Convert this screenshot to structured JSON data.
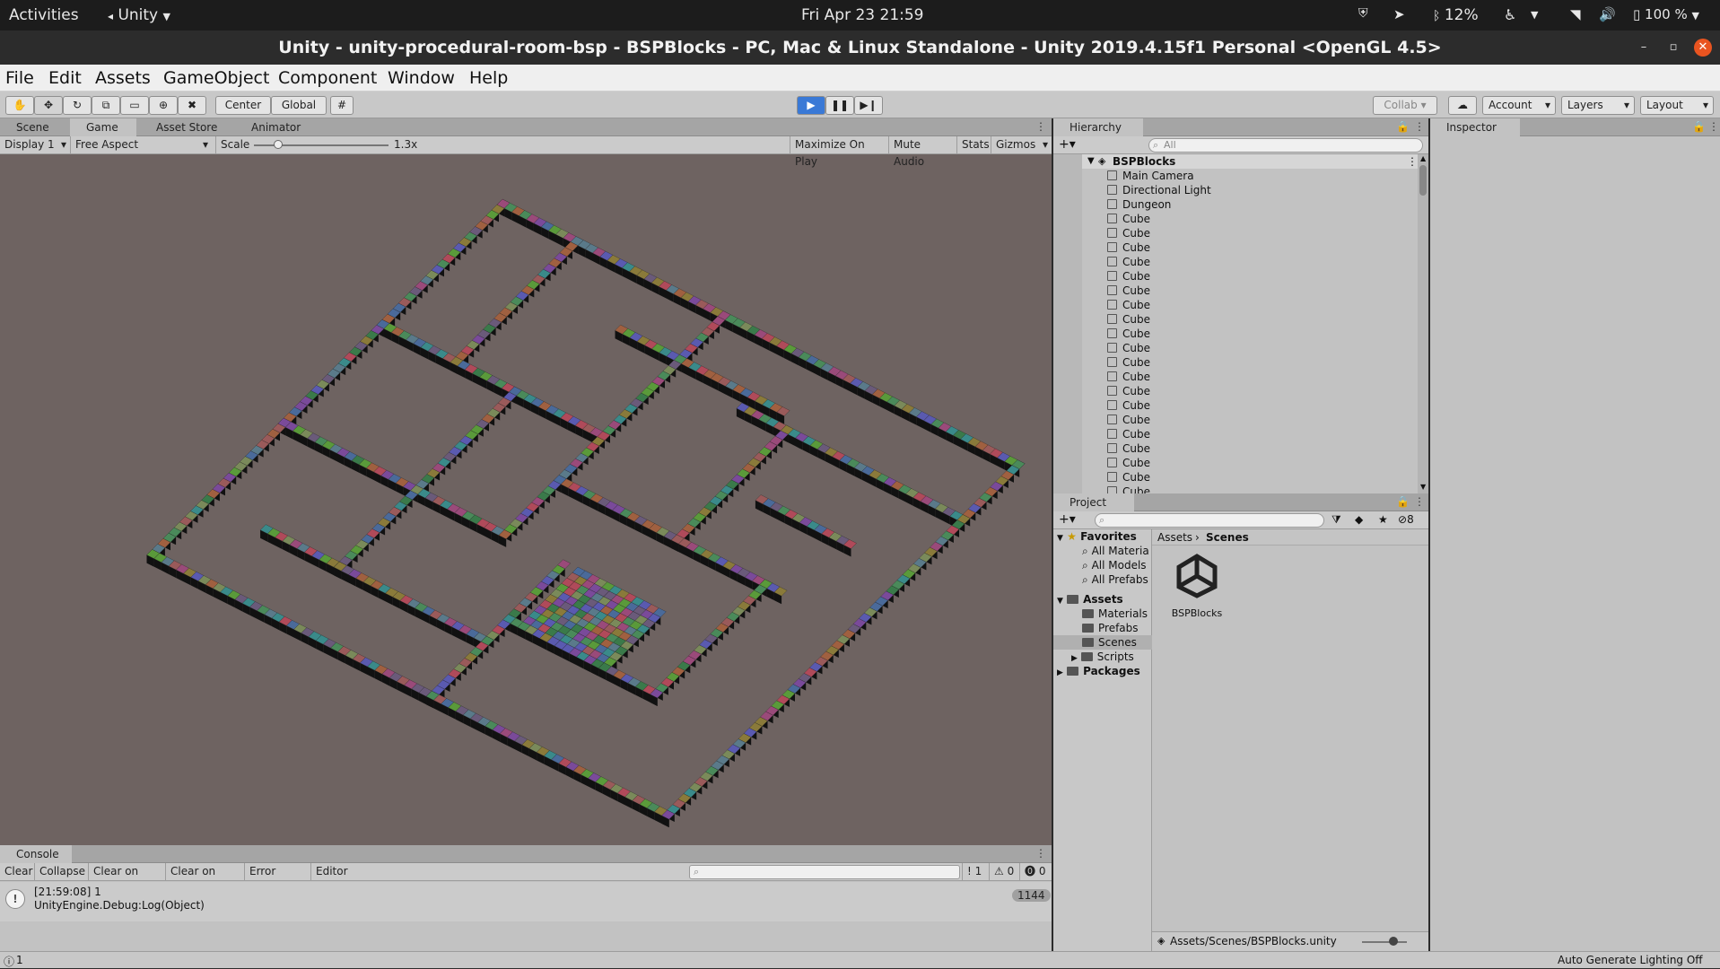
{
  "system_bar": {
    "activities": "Activities",
    "app_name": "Unity",
    "datetime": "Fri Apr 23  21:59",
    "bt_battery": "12%",
    "battery": "100 %"
  },
  "window": {
    "title": "Unity - unity-procedural-room-bsp - BSPBlocks - PC, Mac & Linux Standalone - Unity 2019.4.15f1 Personal <OpenGL 4.5>"
  },
  "menu": [
    "File",
    "Edit",
    "Assets",
    "GameObject",
    "Component",
    "Window",
    "Help"
  ],
  "toolbar": {
    "center_label": "Center",
    "global_label": "Global",
    "collab_label": "Collab",
    "account_label": "Account",
    "layers_label": "Layers",
    "layout_label": "Layout"
  },
  "game_panel": {
    "tabs": [
      "Scene",
      "Game",
      "Asset Store",
      "Animator"
    ],
    "display": "Display 1",
    "aspect": "Free Aspect",
    "scale_label": "Scale",
    "scale_value": 1.3,
    "scale_text": "1.3x",
    "maximize_on_play": "Maximize On Play",
    "mute_audio": "Mute Audio",
    "stats": "Stats",
    "gizmos": "Gizmos"
  },
  "hierarchy": {
    "tab": "Hierarchy",
    "search_placeholder": "All",
    "scene": "BSPBlocks",
    "items": [
      "Main Camera",
      "Directional Light",
      "Dungeon",
      "Cube",
      "Cube",
      "Cube",
      "Cube",
      "Cube",
      "Cube",
      "Cube",
      "Cube",
      "Cube",
      "Cube",
      "Cube",
      "Cube",
      "Cube",
      "Cube",
      "Cube",
      "Cube",
      "Cube",
      "Cube",
      "Cube",
      "Cube"
    ]
  },
  "inspector": {
    "tab": "Inspector"
  },
  "project": {
    "tab": "Project",
    "hidden_count": "8",
    "favorites_label": "Favorites",
    "favorites": [
      "All Materia",
      "All Models",
      "All Prefabs"
    ],
    "assets_label": "Assets",
    "asset_folders": [
      "Materials",
      "Prefabs",
      "Scenes",
      "Scripts"
    ],
    "packages_label": "Packages",
    "breadcrumb_root": "Assets",
    "breadcrumb_current": "Scenes",
    "file_name": "BSPBlocks",
    "path": "Assets/Scenes/BSPBlocks.unity"
  },
  "console": {
    "tab": "Console",
    "buttons": [
      "Clear",
      "Collapse",
      "Clear on Play",
      "Clear on Build",
      "Error Pause",
      "Editor"
    ],
    "log_count": "1",
    "warn_count": "0",
    "error_count": "0",
    "entry_line1": "[21:59:08] 1",
    "entry_line2": "UnityEngine.Debug:Log(Object)",
    "entry_badge": "1144"
  },
  "status": {
    "left": "1",
    "right": "Auto Generate Lighting Off"
  },
  "colors": {
    "bg_game": "#6e6361",
    "panel": "#c2c2c2",
    "play_active": "#3a79d6"
  }
}
